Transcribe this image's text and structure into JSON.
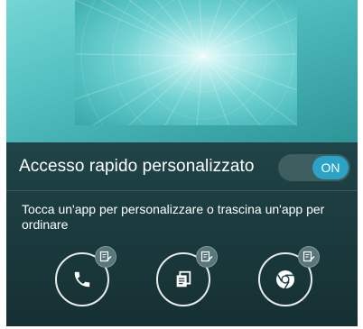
{
  "panel": {
    "title": "Accesso rapido personalizzato",
    "toggle_label": "ON",
    "instructions": "Tocca un'app per personalizzare o trascina un'app per ordinare"
  },
  "shortcuts": [
    {
      "icon": "phone-icon"
    },
    {
      "icon": "messages-icon"
    },
    {
      "icon": "chrome-icon"
    }
  ],
  "colors": {
    "toggle_on": "#2aa3c6",
    "panel_bg": "#1f4447",
    "wallpaper": "#56c2c3"
  }
}
